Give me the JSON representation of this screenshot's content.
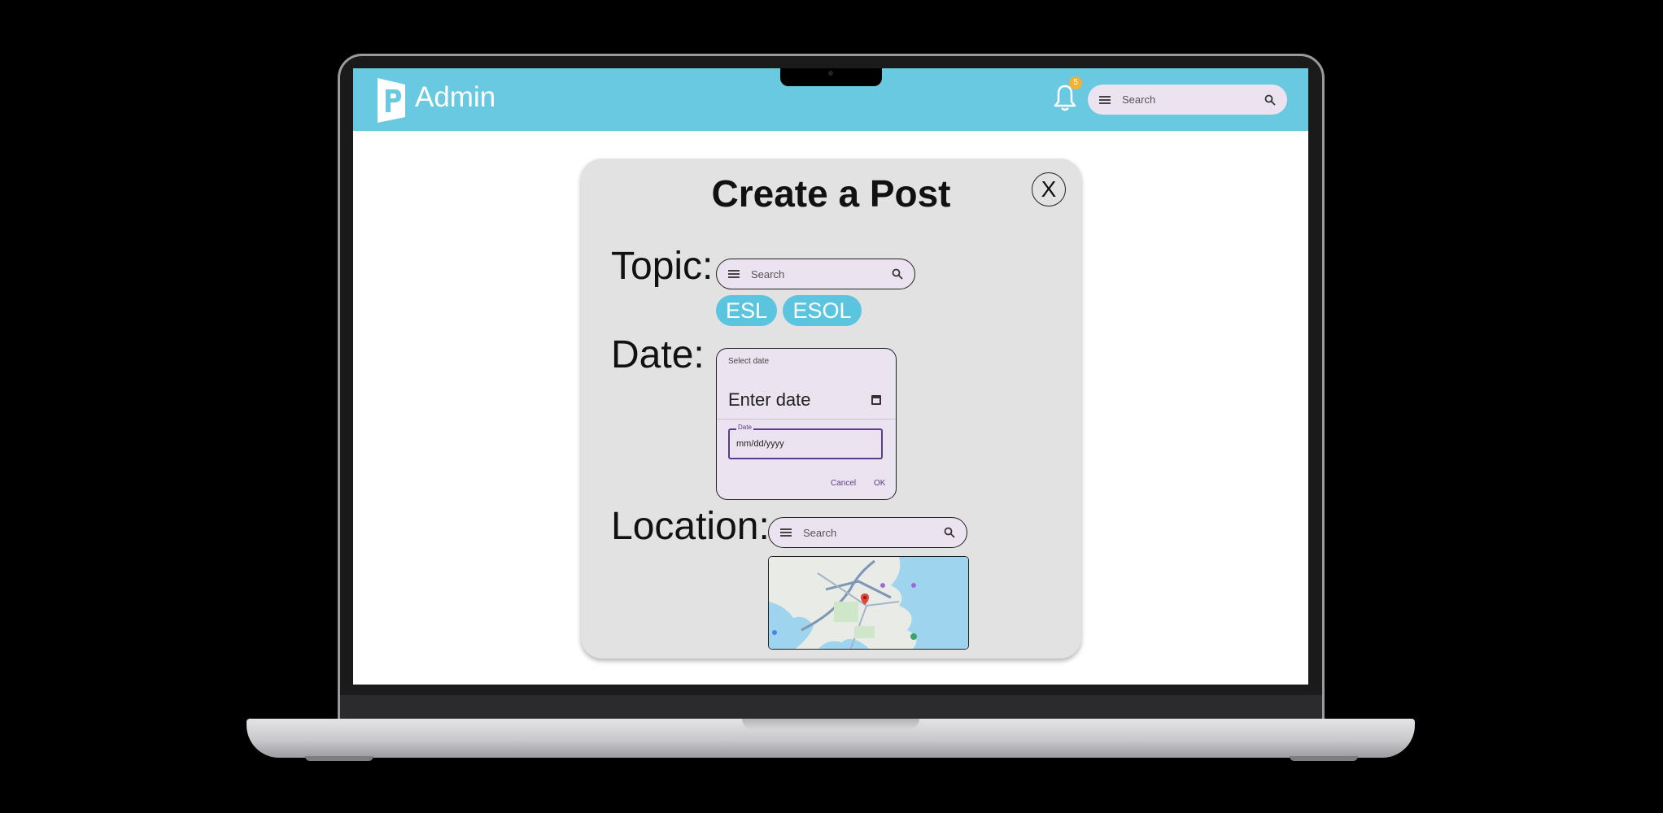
{
  "app": {
    "title": "Admin"
  },
  "header": {
    "notification_count": "5",
    "search_placeholder": "Search"
  },
  "modal": {
    "title": "Create a Post",
    "close_label": "X",
    "topic": {
      "label": "Topic:",
      "search_placeholder": "Search",
      "chips": [
        "ESL",
        "ESOL"
      ]
    },
    "date": {
      "label": "Date:",
      "picker": {
        "header": "Select date",
        "enter_label": "Enter date",
        "input_label": "Date",
        "input_placeholder": "mm/dd/yyyy",
        "cancel_label": "Cancel",
        "ok_label": "OK"
      }
    },
    "location": {
      "label": "Location:",
      "search_placeholder": "Search"
    }
  },
  "colors": {
    "header_bg": "#68c9e1",
    "chip_bg": "#5bc4de",
    "badge_bg": "#f2b233",
    "modal_bg": "#e2e2e2",
    "accent": "#5a3e8a"
  },
  "icons": [
    "logo-icon",
    "bell-icon",
    "menu-icon",
    "search-icon",
    "calendar-icon",
    "map-pin-icon"
  ]
}
